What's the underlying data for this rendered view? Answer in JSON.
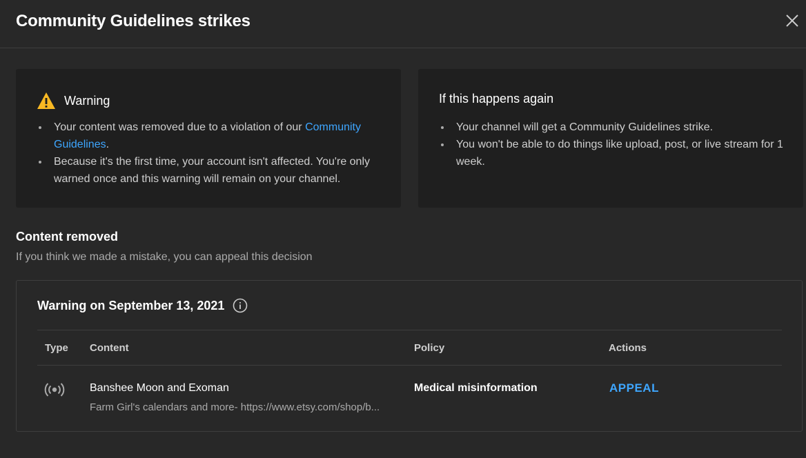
{
  "header": {
    "title": "Community Guidelines strikes",
    "close_icon": "close-icon"
  },
  "warning_card": {
    "title": "Warning",
    "icon": "warning-triangle-icon",
    "bullet1_prefix": "Your content was removed due to a violation of our ",
    "bullet1_link": "Community Guidelines",
    "bullet1_suffix": ".",
    "bullet2": "Because it's the first time, your account isn't affected. You're only warned once and this warning will remain on your channel."
  },
  "again_card": {
    "title": "If this happens again",
    "bullet1": "Your channel will get a Community Guidelines strike.",
    "bullet2": "You won't be able to do things like upload, post, or live stream for 1 week."
  },
  "content_removed": {
    "title": "Content removed",
    "subtitle": "If you think we made a mistake, you can appeal this decision"
  },
  "strike": {
    "title": "Warning on September 13, 2021",
    "info_icon": "info-icon",
    "columns": {
      "type": "Type",
      "content": "Content",
      "policy": "Policy",
      "actions": "Actions"
    },
    "row": {
      "type_icon": "live-broadcast-icon",
      "content_title": "Banshee Moon and Exoman",
      "content_desc": "Farm Girl's calendars and more- https://www.etsy.com/shop/b...",
      "policy": "Medical misinformation",
      "action": "APPEAL"
    }
  },
  "colors": {
    "background": "#282828",
    "card": "#1f1f1f",
    "link": "#3ea6ff",
    "warning": "#f9b923"
  }
}
